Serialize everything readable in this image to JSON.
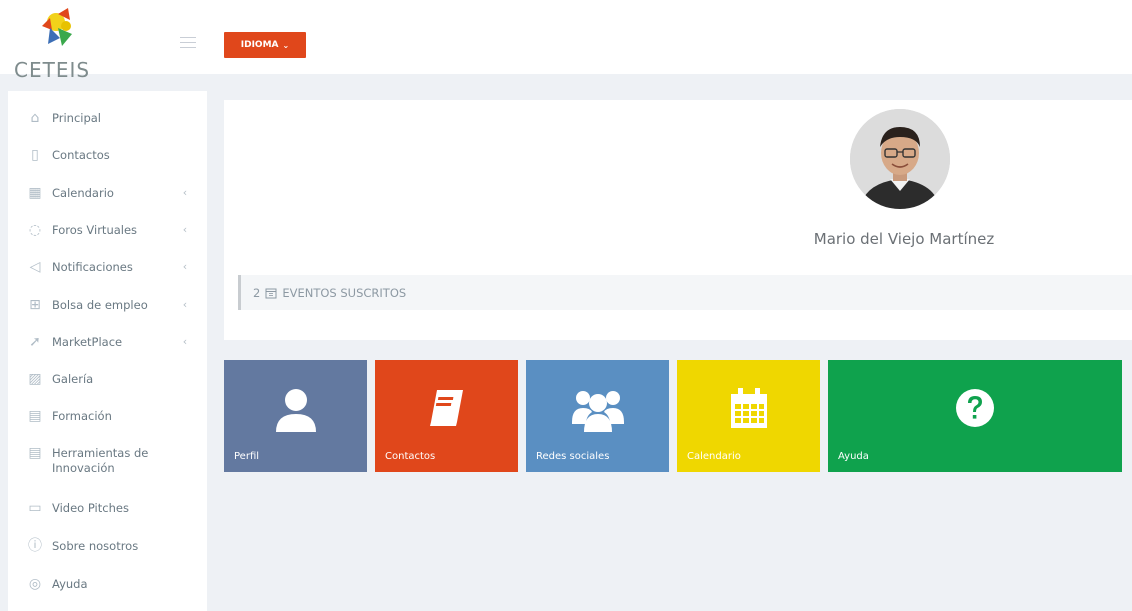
{
  "header": {
    "logo_text": "CETEIS",
    "language_button": "IDIOMA"
  },
  "sidebar": {
    "items": [
      {
        "label": "Principal",
        "icon": "home-icon",
        "has_arrow": false
      },
      {
        "label": "Contactos",
        "icon": "contacts-icon",
        "has_arrow": false
      },
      {
        "label": "Calendario",
        "icon": "calendar-icon",
        "has_arrow": true
      },
      {
        "label": "Foros Virtuales",
        "icon": "chat-icon",
        "has_arrow": true
      },
      {
        "label": "Notificaciones",
        "icon": "send-icon",
        "has_arrow": true
      },
      {
        "label": "Bolsa de empleo",
        "icon": "briefcase-icon",
        "has_arrow": true
      },
      {
        "label": "MarketPlace",
        "icon": "rocket-icon",
        "has_arrow": true
      },
      {
        "label": "Galería",
        "icon": "image-icon",
        "has_arrow": false
      },
      {
        "label": "Formación",
        "icon": "book-icon",
        "has_arrow": false
      },
      {
        "label": "Herramientas de Innovación",
        "icon": "tools-icon",
        "has_arrow": false
      },
      {
        "label": "Video Pitches",
        "icon": "video-icon",
        "has_arrow": false
      },
      {
        "label": "Sobre nosotros",
        "icon": "info-icon",
        "has_arrow": false
      },
      {
        "label": "Ayuda",
        "icon": "lifebuoy-icon",
        "has_arrow": false
      }
    ]
  },
  "profile": {
    "name": "Mario del Viejo Martínez",
    "events_count": "2",
    "events_label": "EVENTOS SUSCRITOS"
  },
  "tiles": [
    {
      "label": "Perfil",
      "icon": "user-icon",
      "color": "#6379a0"
    },
    {
      "label": "Contactos",
      "icon": "book-icon",
      "color": "#e0471b"
    },
    {
      "label": "Redes sociales",
      "icon": "users-icon",
      "color": "#5a8fc2"
    },
    {
      "label": "Calendario",
      "icon": "calendar-icon",
      "color": "#efd700"
    },
    {
      "label": "Ayuda",
      "icon": "question-icon",
      "color": "#0fa24d"
    }
  ],
  "colors": {
    "accent_orange": "#e0471b",
    "page_bg": "#eef1f5"
  }
}
